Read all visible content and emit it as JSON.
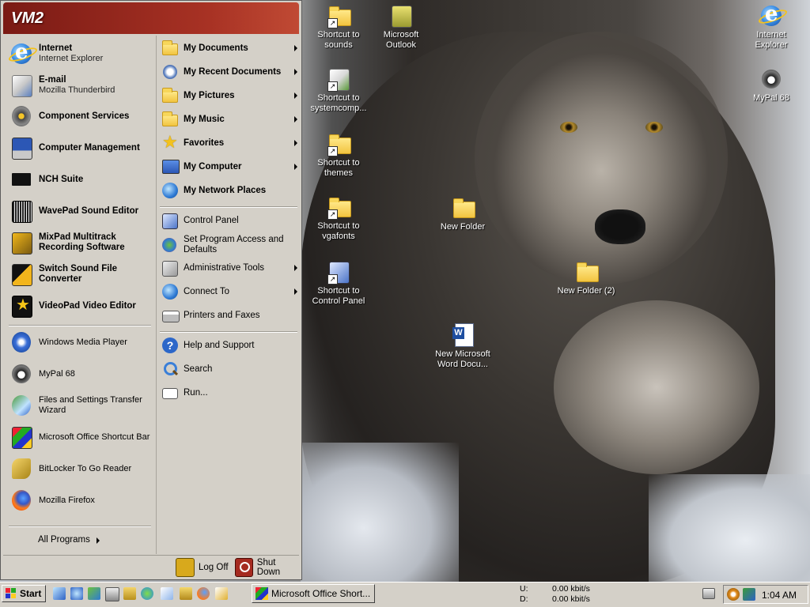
{
  "start_menu": {
    "header_title": "VM2",
    "pinned": [
      {
        "title": "Internet",
        "sub": "Internet Explorer"
      },
      {
        "title": "E-mail",
        "sub": "Mozilla Thunderbird"
      }
    ],
    "programs": [
      {
        "title": "Component Services"
      },
      {
        "title": "Computer Management"
      },
      {
        "title": "NCH Suite"
      },
      {
        "title": "WavePad Sound Editor"
      },
      {
        "title": "MixPad Multitrack",
        "sub": "Recording Software"
      },
      {
        "title": "Switch Sound File",
        "sub": "Converter"
      },
      {
        "title": "VideoPad Video Editor"
      }
    ],
    "recent": [
      "Windows Media Player",
      "MyPal 68",
      "Files and Settings Transfer\nWizard",
      "Microsoft Office Shortcut Bar",
      "BitLocker To Go Reader",
      "Mozilla Firefox"
    ],
    "all_programs": "All Programs",
    "right_top": [
      "My Documents",
      "My Recent Documents",
      "My Pictures",
      "My Music",
      "Favorites",
      "My Computer",
      "My Network Places"
    ],
    "right_mid": [
      "Control Panel",
      "Set Program Access and\nDefaults",
      "Administrative Tools",
      "Connect To",
      "Printers and Faxes"
    ],
    "right_bottom": [
      "Help and Support",
      "Search",
      "Run..."
    ],
    "log_off": "Log Off",
    "shut_down": "Shut Down"
  },
  "desktop_icons": [
    {
      "label": "Shortcut to\nsounds",
      "icon": "folder-shortcut-icon"
    },
    {
      "label": "Microsoft\nOutlook",
      "icon": "outlook-icon"
    },
    {
      "label": "Shortcut to\nsystemcomp...",
      "icon": "system-shortcut-icon"
    },
    {
      "label": "Shortcut to\nthemes",
      "icon": "folder-shortcut-icon"
    },
    {
      "label": "Shortcut to\nvgafonts",
      "icon": "folder-shortcut-icon"
    },
    {
      "label": "Shortcut to\nControl Panel",
      "icon": "control-panel-shortcut-icon"
    },
    {
      "label": "New Folder",
      "icon": "folder-icon"
    },
    {
      "label": "New Folder (2)",
      "icon": "folder-icon"
    },
    {
      "label": "New Microsoft\nWord Docu...",
      "icon": "word-document-icon"
    },
    {
      "label": "Internet\nExplorer",
      "icon": "internet-explorer-icon"
    },
    {
      "label": "MyPal 68",
      "icon": "mypal-icon"
    }
  ],
  "taskbar": {
    "start_label": "Start",
    "task_button": "Microsoft Office Short...",
    "net_u_label": "U:",
    "net_d_label": "D:",
    "net_u_value": "0.00 kbit/s",
    "net_d_value": "0.00 kbit/s",
    "clock": "1:04 AM"
  },
  "colors": {
    "menu_header": "#a83224",
    "menu_bg": "#d4d0c8",
    "taskbar_bg": "#d4d0c8"
  }
}
